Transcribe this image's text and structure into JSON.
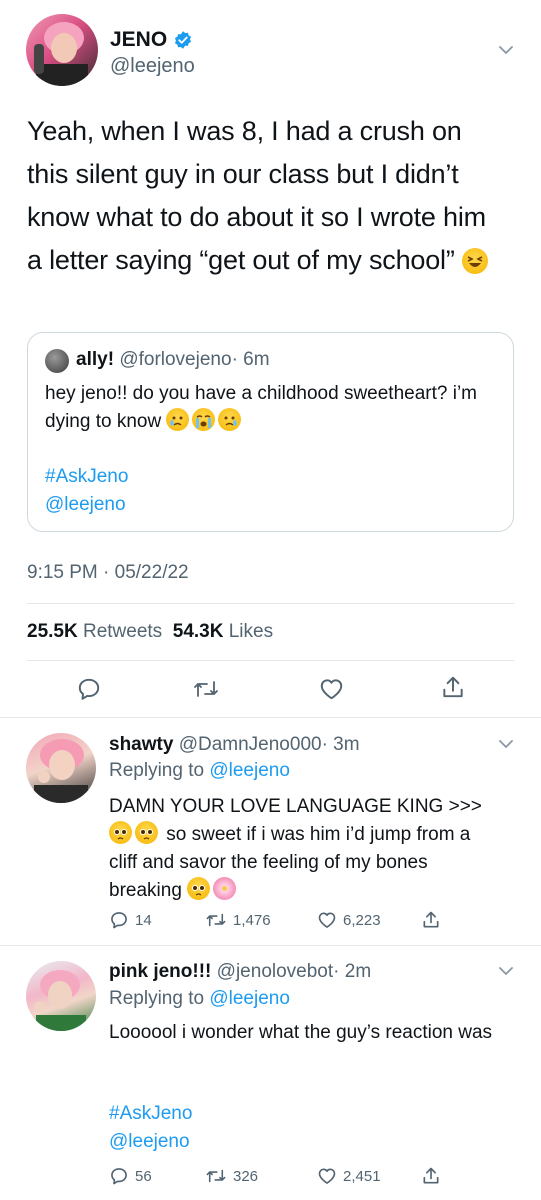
{
  "main_tweet": {
    "name": "JENO",
    "handle": "@leejeno",
    "text": "Yeah, when I was 8, I had a crush on this silent guy in our class but I didn’t know what to do about it so I wrote him a letter saying “get out of my school”",
    "timestamp": "9:15 PM · 05/22/22",
    "retweets": "25.5K",
    "retweets_label": "Retweets",
    "likes": "54.3K",
    "likes_label": "Likes"
  },
  "quoted_tweet": {
    "name": "ally!",
    "handle": "@forlovejeno",
    "time": "· 6m",
    "text": "hey jeno!! do you have a childhood sweetheart? i’m dying to know",
    "hashtag": "#AskJeno",
    "mention": "@leejeno"
  },
  "replies": [
    {
      "name": "shawty",
      "handle": "@DamnJeno000",
      "time": "· 3m",
      "replying_label": "Replying to",
      "replying_to": "@leejeno",
      "line1": "DAMN YOUR LOVE LANGUAGE KING >>>",
      "line2": "so sweet if i was him i’d jump from a",
      "line3": "cliff and savor the feeling of my bones",
      "line4": "breaking",
      "reply_count": "14",
      "retweet_count": "1,476",
      "like_count": "6,223"
    },
    {
      "name": "pink jeno!!!",
      "handle": "@jenolovebot",
      "time": "· 2m",
      "replying_label": "Replying to",
      "replying_to": "@leejeno",
      "text": "Loooool i wonder what the guy’s reaction was",
      "hashtag": "#AskJeno",
      "mention": "@leejeno",
      "reply_count": "56",
      "retweet_count": "326",
      "like_count": "2,451"
    }
  ],
  "colors": {
    "accent": "#1d9bf0",
    "secondary_text": "#536471",
    "divider": "#e4e8eb"
  },
  "icons": [
    "verified-badge-icon",
    "chevron-down-icon",
    "reply-icon",
    "retweet-icon",
    "like-icon",
    "share-icon"
  ]
}
